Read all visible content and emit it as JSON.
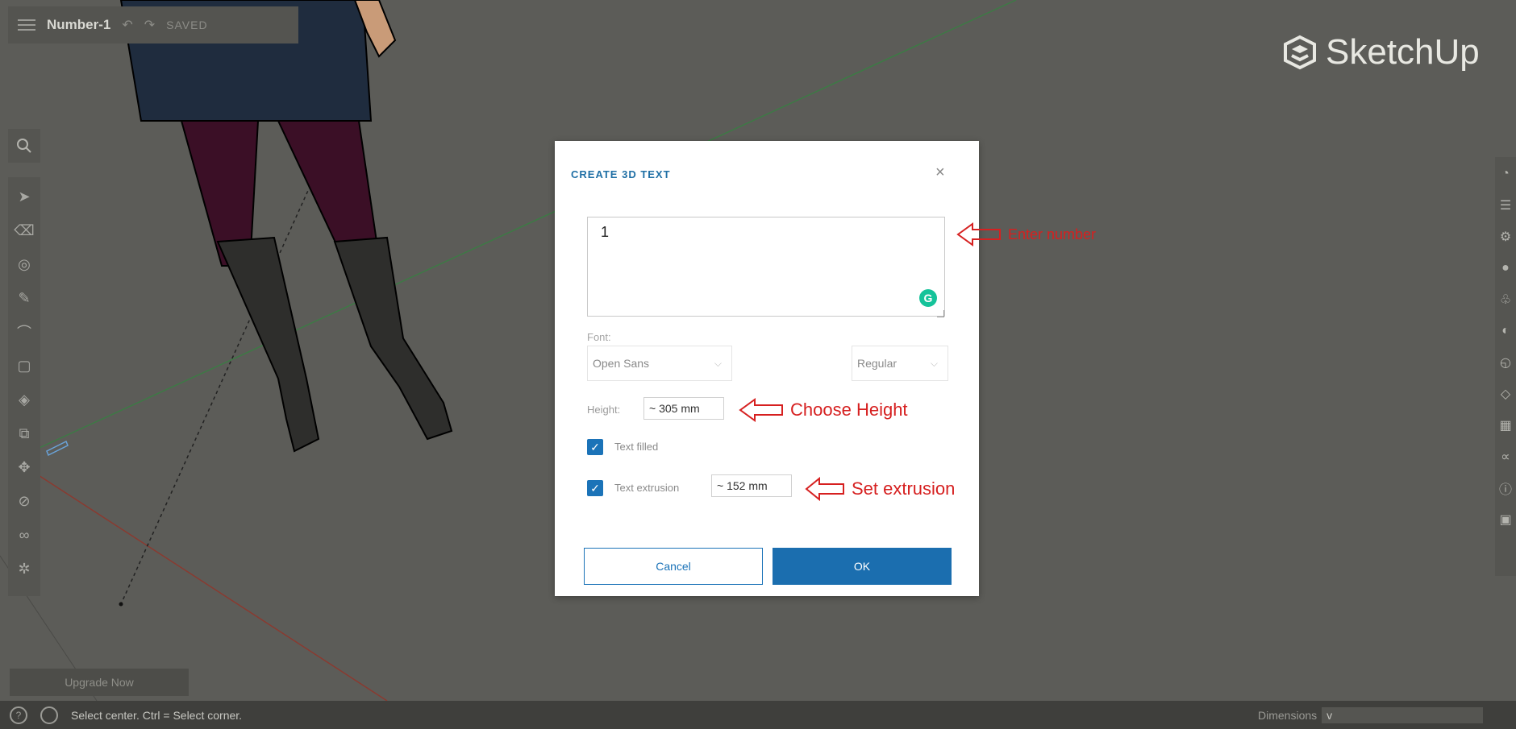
{
  "app": {
    "file_name": "Number-1",
    "save_status": "SAVED",
    "logo_text": "SketchUp",
    "upgrade_label": "Upgrade Now"
  },
  "status_bar": {
    "hint": "Select center. Ctrl = Select corner.",
    "dimensions_label": "Dimensions",
    "dimensions_value": "v"
  },
  "dialog": {
    "title": "CREATE 3D TEXT",
    "text_value": "1",
    "font_label": "Font:",
    "font_value": "Open Sans",
    "style_value": "Regular",
    "height_label": "Height:",
    "height_value": "~ 305 mm",
    "text_filled_label": "Text filled",
    "text_filled_checked": true,
    "text_extrusion_label": "Text extrusion",
    "text_extrusion_checked": true,
    "extrusion_value": "~ 152 mm",
    "cancel_label": "Cancel",
    "ok_label": "OK"
  },
  "annotations": {
    "enter_number": "Enter number",
    "choose_height": "Choose Height",
    "set_extrusion": "Set extrusion"
  },
  "colors": {
    "accent": "#1b6eaf",
    "annotation": "#d62020",
    "viewport_bg": "#5c5c58"
  }
}
